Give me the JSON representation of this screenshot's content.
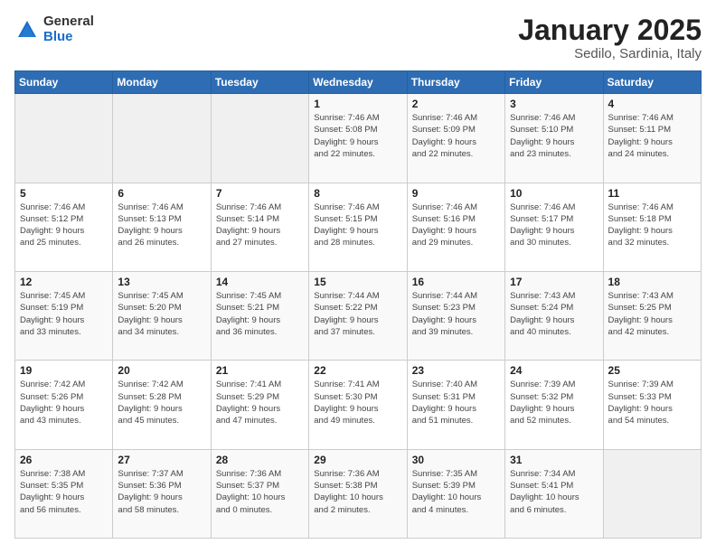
{
  "logo": {
    "general": "General",
    "blue": "Blue"
  },
  "title": {
    "month": "January 2025",
    "location": "Sedilo, Sardinia, Italy"
  },
  "weekdays": [
    "Sunday",
    "Monday",
    "Tuesday",
    "Wednesday",
    "Thursday",
    "Friday",
    "Saturday"
  ],
  "weeks": [
    [
      {
        "day": "",
        "info": ""
      },
      {
        "day": "",
        "info": ""
      },
      {
        "day": "",
        "info": ""
      },
      {
        "day": "1",
        "info": "Sunrise: 7:46 AM\nSunset: 5:08 PM\nDaylight: 9 hours\nand 22 minutes."
      },
      {
        "day": "2",
        "info": "Sunrise: 7:46 AM\nSunset: 5:09 PM\nDaylight: 9 hours\nand 22 minutes."
      },
      {
        "day": "3",
        "info": "Sunrise: 7:46 AM\nSunset: 5:10 PM\nDaylight: 9 hours\nand 23 minutes."
      },
      {
        "day": "4",
        "info": "Sunrise: 7:46 AM\nSunset: 5:11 PM\nDaylight: 9 hours\nand 24 minutes."
      }
    ],
    [
      {
        "day": "5",
        "info": "Sunrise: 7:46 AM\nSunset: 5:12 PM\nDaylight: 9 hours\nand 25 minutes."
      },
      {
        "day": "6",
        "info": "Sunrise: 7:46 AM\nSunset: 5:13 PM\nDaylight: 9 hours\nand 26 minutes."
      },
      {
        "day": "7",
        "info": "Sunrise: 7:46 AM\nSunset: 5:14 PM\nDaylight: 9 hours\nand 27 minutes."
      },
      {
        "day": "8",
        "info": "Sunrise: 7:46 AM\nSunset: 5:15 PM\nDaylight: 9 hours\nand 28 minutes."
      },
      {
        "day": "9",
        "info": "Sunrise: 7:46 AM\nSunset: 5:16 PM\nDaylight: 9 hours\nand 29 minutes."
      },
      {
        "day": "10",
        "info": "Sunrise: 7:46 AM\nSunset: 5:17 PM\nDaylight: 9 hours\nand 30 minutes."
      },
      {
        "day": "11",
        "info": "Sunrise: 7:46 AM\nSunset: 5:18 PM\nDaylight: 9 hours\nand 32 minutes."
      }
    ],
    [
      {
        "day": "12",
        "info": "Sunrise: 7:45 AM\nSunset: 5:19 PM\nDaylight: 9 hours\nand 33 minutes."
      },
      {
        "day": "13",
        "info": "Sunrise: 7:45 AM\nSunset: 5:20 PM\nDaylight: 9 hours\nand 34 minutes."
      },
      {
        "day": "14",
        "info": "Sunrise: 7:45 AM\nSunset: 5:21 PM\nDaylight: 9 hours\nand 36 minutes."
      },
      {
        "day": "15",
        "info": "Sunrise: 7:44 AM\nSunset: 5:22 PM\nDaylight: 9 hours\nand 37 minutes."
      },
      {
        "day": "16",
        "info": "Sunrise: 7:44 AM\nSunset: 5:23 PM\nDaylight: 9 hours\nand 39 minutes."
      },
      {
        "day": "17",
        "info": "Sunrise: 7:43 AM\nSunset: 5:24 PM\nDaylight: 9 hours\nand 40 minutes."
      },
      {
        "day": "18",
        "info": "Sunrise: 7:43 AM\nSunset: 5:25 PM\nDaylight: 9 hours\nand 42 minutes."
      }
    ],
    [
      {
        "day": "19",
        "info": "Sunrise: 7:42 AM\nSunset: 5:26 PM\nDaylight: 9 hours\nand 43 minutes."
      },
      {
        "day": "20",
        "info": "Sunrise: 7:42 AM\nSunset: 5:28 PM\nDaylight: 9 hours\nand 45 minutes."
      },
      {
        "day": "21",
        "info": "Sunrise: 7:41 AM\nSunset: 5:29 PM\nDaylight: 9 hours\nand 47 minutes."
      },
      {
        "day": "22",
        "info": "Sunrise: 7:41 AM\nSunset: 5:30 PM\nDaylight: 9 hours\nand 49 minutes."
      },
      {
        "day": "23",
        "info": "Sunrise: 7:40 AM\nSunset: 5:31 PM\nDaylight: 9 hours\nand 51 minutes."
      },
      {
        "day": "24",
        "info": "Sunrise: 7:39 AM\nSunset: 5:32 PM\nDaylight: 9 hours\nand 52 minutes."
      },
      {
        "day": "25",
        "info": "Sunrise: 7:39 AM\nSunset: 5:33 PM\nDaylight: 9 hours\nand 54 minutes."
      }
    ],
    [
      {
        "day": "26",
        "info": "Sunrise: 7:38 AM\nSunset: 5:35 PM\nDaylight: 9 hours\nand 56 minutes."
      },
      {
        "day": "27",
        "info": "Sunrise: 7:37 AM\nSunset: 5:36 PM\nDaylight: 9 hours\nand 58 minutes."
      },
      {
        "day": "28",
        "info": "Sunrise: 7:36 AM\nSunset: 5:37 PM\nDaylight: 10 hours\nand 0 minutes."
      },
      {
        "day": "29",
        "info": "Sunrise: 7:36 AM\nSunset: 5:38 PM\nDaylight: 10 hours\nand 2 minutes."
      },
      {
        "day": "30",
        "info": "Sunrise: 7:35 AM\nSunset: 5:39 PM\nDaylight: 10 hours\nand 4 minutes."
      },
      {
        "day": "31",
        "info": "Sunrise: 7:34 AM\nSunset: 5:41 PM\nDaylight: 10 hours\nand 6 minutes."
      },
      {
        "day": "",
        "info": ""
      }
    ]
  ]
}
